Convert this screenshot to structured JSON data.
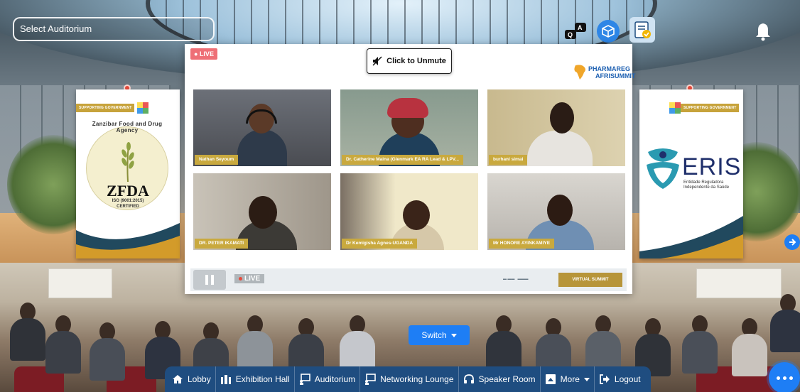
{
  "auditorium_select": {
    "placeholder": "Select Auditorium"
  },
  "top_icons": [
    "qa-icon",
    "box-icon",
    "checklist-icon",
    "bell-icon"
  ],
  "video": {
    "live_label": "LIVE",
    "unmute_label": "Click to Unmute",
    "event_logo_line1": "PHARMAREG",
    "event_logo_line2": "AFRISUMMIT",
    "participants": [
      {
        "name": "Nathan Seyoum"
      },
      {
        "name": "Dr. Catherine Maina (Glenmark EA RA Lead & LPV..."
      },
      {
        "name": "burhani simai"
      },
      {
        "name": "DR. PETER IKAMATI"
      },
      {
        "name": "Dr Kemigisha Agnes-UGANDA"
      },
      {
        "name": "Mr HONORE AYINKAMIYE"
      }
    ],
    "player_live_label": "LIVE",
    "player_sponsor_label": "VIRTUAL SUMMIT"
  },
  "banners": {
    "left": {
      "ribbon": "SUPPORTING GOVERNMENT",
      "arc_text": "Zanzibar Food and Drug Agency",
      "org_short": "ZFDA",
      "iso": "ISO (9001:2015)",
      "certified": "CERTIFIED"
    },
    "right": {
      "ribbon": "SUPPORTING GOVERNMENT",
      "org_short": "ERIS",
      "line1": "Entidade Reguladora",
      "line2": "Independente da Saúde"
    }
  },
  "switch": {
    "label": "Switch"
  },
  "nav": {
    "items": [
      {
        "label": "Lobby",
        "icon": "home-icon"
      },
      {
        "label": "Exhibition Hall",
        "icon": "exhibition-icon"
      },
      {
        "label": "Auditorium",
        "icon": "presentation-icon"
      },
      {
        "label": "Networking Lounge",
        "icon": "presentation-icon"
      },
      {
        "label": "Speaker Room",
        "icon": "headset-icon"
      },
      {
        "label": "More",
        "icon": "slides-icon"
      },
      {
        "label": "Logout",
        "icon": "logout-icon"
      }
    ]
  },
  "colors": {
    "accent": "#1e7ef5",
    "nav_bg": "#1f4d80",
    "name_tag": "#c9a93e",
    "live": "#ee6f76"
  }
}
